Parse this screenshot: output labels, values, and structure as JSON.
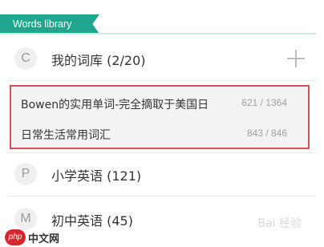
{
  "colors": {
    "accent": "#21a58f",
    "highlight_border": "#d94b5e",
    "panel_bg": "#f3f3f3"
  },
  "header": {
    "title": "Words library"
  },
  "groups": [
    {
      "avatar_letter": "C",
      "label": "我的词库 (2/20)",
      "add_icon": "plus-icon",
      "items": [
        {
          "title": "Bowen的实用单词-完全摘取于美国日",
          "count": "621 / 1364"
        },
        {
          "title": "日常生活常用词汇",
          "count": "843 / 846"
        }
      ]
    },
    {
      "avatar_letter": "P",
      "label": "小学英语 (121)"
    },
    {
      "avatar_letter": "M",
      "label": "初中英语 (45)"
    }
  ],
  "watermark": {
    "baidu_text": "Bai 经验",
    "php_logo": "php",
    "php_text": "中文网"
  }
}
